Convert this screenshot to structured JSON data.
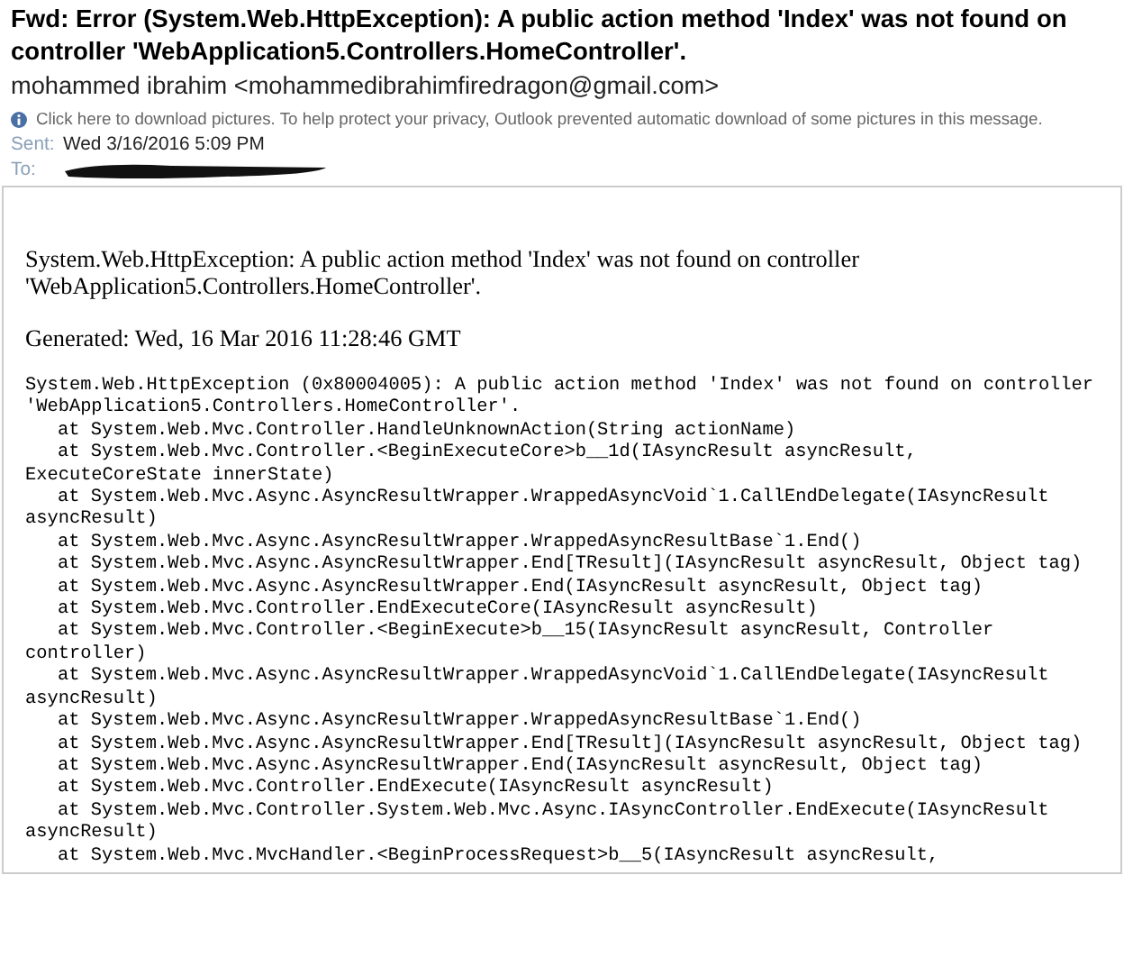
{
  "subject": "Fwd: Error (System.Web.HttpException): A public action method 'Index' was not found on controller 'WebApplication5.Controllers.HomeController'.",
  "from": "mohammed ibrahim <mohammedibrahimfiredragon@gmail.com>",
  "info_bar": "Click here to download pictures. To help protect your privacy, Outlook prevented automatic download of some pictures in this message.",
  "sent": {
    "label": "Sent:",
    "value": "Wed 3/16/2016 5:09 PM"
  },
  "to": {
    "label": "To:"
  },
  "body": {
    "message": "System.Web.HttpException: A public action method 'Index' was not found on controller 'WebApplication5.Controllers.HomeController'.",
    "generated": "Generated: Wed, 16 Mar 2016 11:28:46 GMT",
    "trace": [
      {
        "kind": "head",
        "text": "System.Web.HttpException (0x80004005): A public action method 'Index' was not found on controller"
      },
      {
        "kind": "wrap",
        "text": "'WebApplication5.Controllers.HomeController'."
      },
      {
        "kind": "frame",
        "text": "at System.Web.Mvc.Controller.HandleUnknownAction(String actionName)"
      },
      {
        "kind": "frame",
        "text": "at System.Web.Mvc.Controller.<BeginExecuteCore>b__1d(IAsyncResult asyncResult,"
      },
      {
        "kind": "wrap",
        "text": "ExecuteCoreState innerState)"
      },
      {
        "kind": "frame",
        "text": "at System.Web.Mvc.Async.AsyncResultWrapper.WrappedAsyncVoid`1.CallEndDelegate(IAsyncResult"
      },
      {
        "kind": "wrap",
        "text": "asyncResult)"
      },
      {
        "kind": "frame",
        "text": "at System.Web.Mvc.Async.AsyncResultWrapper.WrappedAsyncResultBase`1.End()"
      },
      {
        "kind": "frame",
        "text": "at System.Web.Mvc.Async.AsyncResultWrapper.End[TResult](IAsyncResult asyncResult, Object tag)"
      },
      {
        "kind": "frame",
        "text": "at System.Web.Mvc.Async.AsyncResultWrapper.End(IAsyncResult asyncResult, Object tag)"
      },
      {
        "kind": "frame",
        "text": "at System.Web.Mvc.Controller.EndExecuteCore(IAsyncResult asyncResult)"
      },
      {
        "kind": "frame",
        "text": "at System.Web.Mvc.Controller.<BeginExecute>b__15(IAsyncResult asyncResult, Controller"
      },
      {
        "kind": "wrap",
        "text": "controller)"
      },
      {
        "kind": "frame",
        "text": "at System.Web.Mvc.Async.AsyncResultWrapper.WrappedAsyncVoid`1.CallEndDelegate(IAsyncResult"
      },
      {
        "kind": "wrap",
        "text": "asyncResult)"
      },
      {
        "kind": "frame",
        "text": "at System.Web.Mvc.Async.AsyncResultWrapper.WrappedAsyncResultBase`1.End()"
      },
      {
        "kind": "frame",
        "text": "at System.Web.Mvc.Async.AsyncResultWrapper.End[TResult](IAsyncResult asyncResult, Object tag)"
      },
      {
        "kind": "frame",
        "text": "at System.Web.Mvc.Async.AsyncResultWrapper.End(IAsyncResult asyncResult, Object tag)"
      },
      {
        "kind": "frame",
        "text": "at System.Web.Mvc.Controller.EndExecute(IAsyncResult asyncResult)"
      },
      {
        "kind": "frame",
        "text": "at System.Web.Mvc.Controller.System.Web.Mvc.Async.IAsyncController.EndExecute(IAsyncResult"
      },
      {
        "kind": "wrap",
        "text": "asyncResult)"
      },
      {
        "kind": "frame",
        "text": "at System.Web.Mvc.MvcHandler.<BeginProcessRequest>b__5(IAsyncResult asyncResult,"
      }
    ]
  }
}
